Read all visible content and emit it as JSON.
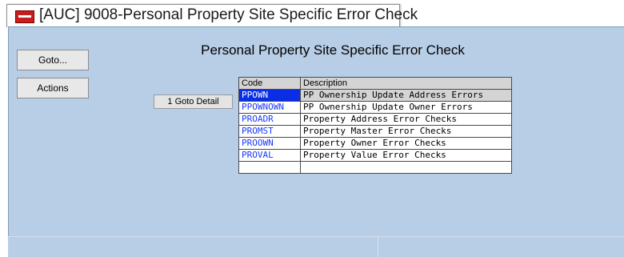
{
  "window": {
    "title": "[AUC] 9008-Personal Property Site Specific Error Check"
  },
  "sidebar": {
    "goto_label": "Goto...",
    "actions_label": "Actions"
  },
  "main": {
    "page_title": "Personal Property Site Specific Error Check",
    "goto_detail_label": "1 Goto Detail",
    "table": {
      "columns": [
        "Code",
        "Description"
      ],
      "rows": [
        {
          "code": "PPOWN",
          "description": "PP Ownership Update Address Errors",
          "selected": true
        },
        {
          "code": "PPOWNOWN",
          "description": "PP Ownership Update Owner Errors"
        },
        {
          "code": "PROADR",
          "description": "Property Address Error Checks"
        },
        {
          "code": "PROMST",
          "description": "Property Master Error Checks"
        },
        {
          "code": "PROOWN",
          "description": "Property Owner Error Checks"
        },
        {
          "code": "PROVAL",
          "description": "Property Value Error Checks"
        },
        {
          "code": "",
          "description": ""
        }
      ]
    }
  },
  "colors": {
    "client_background": "#b8cde6",
    "selected_code_bg": "#0a2ee6",
    "code_text": "#1a3aff"
  }
}
